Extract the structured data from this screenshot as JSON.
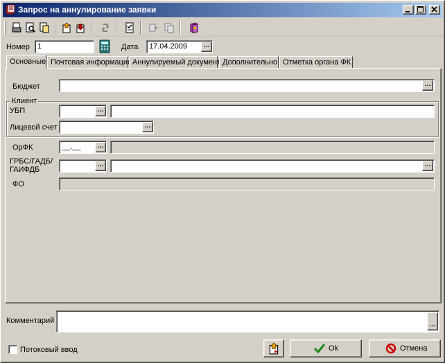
{
  "window": {
    "title": "Запрос на аннулирование заявки"
  },
  "header": {
    "number_label": "Номер",
    "number_value": "1",
    "date_label": "Дата",
    "date_value": "17.04.2009"
  },
  "tabs": [
    {
      "label": "Основные"
    },
    {
      "label": "Почтовая информация"
    },
    {
      "label": "Аннулируемый документ"
    },
    {
      "label": "Дополнительно"
    },
    {
      "label": "Отметка органа ФК"
    }
  ],
  "main": {
    "budget_label": "Бюджет",
    "client_group_title": "Клиент",
    "ubp_label": "УБП",
    "account_label": "Лицевой счет",
    "orfk_label": "ОрФК",
    "orfk_value": "__.__",
    "grbs_label_line1": "ГРБС/ГАДБ/",
    "grbs_label_line2": "ГАИФДБ",
    "fo_label": "ФО"
  },
  "footer": {
    "comment_label": "Комментарий",
    "stream_input_label": "Потоковый ввод",
    "ok_label": "Ok",
    "cancel_label": "Отмена"
  },
  "colors": {
    "title_gradient_start": "#0a246a",
    "title_gradient_end": "#a6caf0",
    "face": "#d4d0c8",
    "ok_check": "#1a8a1a",
    "cancel_red": "#cc0000"
  }
}
